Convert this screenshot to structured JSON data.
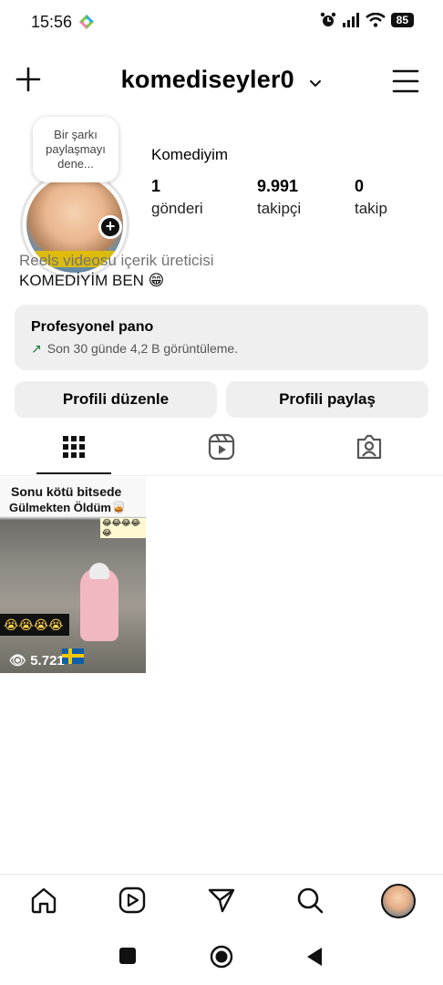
{
  "status": {
    "time": "15:56",
    "battery": "85",
    "icons": [
      "alarm-icon",
      "signal-icon",
      "wifi-icon",
      "battery-icon"
    ]
  },
  "header": {
    "username": "komediseyler0",
    "icons": [
      "plus-icon",
      "chevron-down-icon",
      "menu-icon"
    ]
  },
  "profile": {
    "note_bubble": "Bir şarkı paylaşmayı dene...",
    "display_name": "Komediyim",
    "stats": [
      {
        "value": "1",
        "label": "gönderi"
      },
      {
        "value": "9.991",
        "label": "takipçi"
      },
      {
        "value": "0",
        "label": "takip"
      }
    ],
    "category": "Reels videosu içerik üreticisi",
    "bio": "KOMEDİYİM BEN 😁"
  },
  "pro_panel": {
    "title": "Profesyonel pano",
    "subtitle": "Son 30 günde 4,2 B görüntüleme.",
    "accent_color": "#0a7d3a"
  },
  "actions": {
    "edit": "Profili düzenle",
    "share": "Profili paylaş"
  },
  "tabs": [
    "grid-icon",
    "reels-icon",
    "tagged-icon"
  ],
  "posts": [
    {
      "caption_line1": "Sonu kötü bitsede",
      "caption_line2": "Gülmekten Öldüm🥃",
      "overlay_emojis": "😭😭😭😭",
      "strip_emojis": "😂😂😂😂😂",
      "views": "5.721"
    }
  ],
  "bottom_nav": [
    "home-icon",
    "reels-icon",
    "send-icon",
    "search-icon",
    "profile-avatar"
  ]
}
